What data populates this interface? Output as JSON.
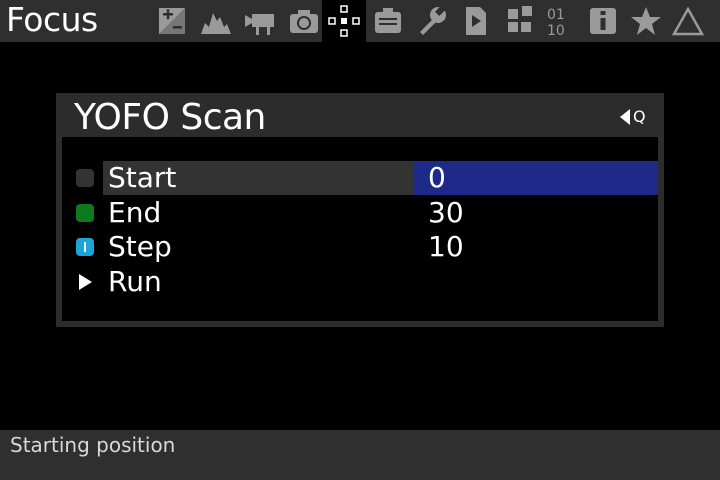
{
  "topbar": {
    "title": "Focus",
    "tabs": [
      {
        "icon": "exposure-icon",
        "active": false
      },
      {
        "icon": "histogram-icon",
        "active": false
      },
      {
        "icon": "movie-camera-icon",
        "active": false
      },
      {
        "icon": "camera-icon",
        "active": false
      },
      {
        "icon": "focus-icon",
        "active": true
      },
      {
        "icon": "display-icon",
        "active": false
      },
      {
        "icon": "wrench-icon",
        "active": false
      },
      {
        "icon": "script-icon",
        "active": false
      },
      {
        "icon": "modules-icon",
        "active": false
      },
      {
        "icon": "debug-icon",
        "active": false
      },
      {
        "icon": "info-icon",
        "active": false
      },
      {
        "icon": "star-icon",
        "active": false
      },
      {
        "icon": "delta-icon",
        "active": false
      }
    ]
  },
  "dialog": {
    "title": "YOFO Scan",
    "back_q": "Q",
    "rows": [
      {
        "label": "Start",
        "value": "0",
        "marker": "gray-square",
        "marker_color": "#333333",
        "selected": true
      },
      {
        "label": "End",
        "value": "30",
        "marker": "green-square",
        "marker_color": "#0d7a1d",
        "selected": false
      },
      {
        "label": "Step",
        "value": "10",
        "marker": "cyan-square",
        "marker_color": "#1aa7d8",
        "selected": false
      },
      {
        "label": "Run",
        "value": "",
        "marker": "play-triangle",
        "marker_color": "#ffffff",
        "selected": false
      }
    ]
  },
  "help": {
    "text": "Starting position"
  },
  "colors": {
    "bar_bg": "#2f2f2f",
    "selected_label_bg": "#333333",
    "selected_value_bg": "#1e2a8a"
  }
}
